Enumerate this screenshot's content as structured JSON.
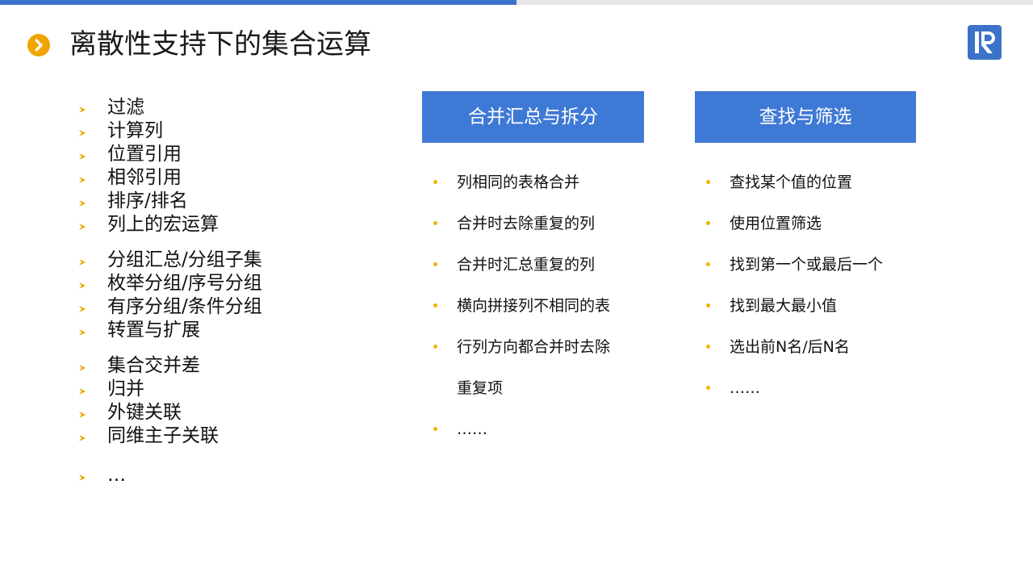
{
  "progress": {
    "fraction": 0.5,
    "fill_color": "#3c72c9",
    "track_color": "#e6e6e6"
  },
  "title": {
    "icon": "chevron-right-circle-icon",
    "icon_color": "#f0a500",
    "text": "离散性支持下的集合运算"
  },
  "logo": {
    "icon": "brand-logo-icon",
    "color": "#3c72c9"
  },
  "left_list": {
    "bullet_icon": "arrow-bullet-icon",
    "bullet_color": "#e6a800",
    "groups": [
      [
        "过滤",
        "计算列",
        "位置引用",
        "相邻引用",
        "排序/排名",
        "列上的宏运算"
      ],
      [
        "分组汇总/分组子集",
        "枚举分组/序号分组",
        "有序分组/条件分组",
        "转置与扩展"
      ],
      [
        "集合交并差",
        "归并",
        "外键关联",
        "同维主子关联"
      ],
      [
        "…"
      ]
    ]
  },
  "columns": [
    {
      "header": "合并汇总与拆分",
      "items": [
        "列相同的表格合并",
        "合并时去除重复的列",
        "合并时汇总重复的列",
        "横向拼接列不相同的表",
        "行列方向都合并时去除",
        "重复项",
        "……"
      ],
      "continuation_index": 5
    },
    {
      "header": "查找与筛选",
      "items": [
        "查找某个值的位置",
        "使用位置筛选",
        "找到第一个或最后一个",
        "找到最大最小值",
        "选出前N名/后N名",
        "……"
      ],
      "continuation_index": -1
    }
  ],
  "header_color": "#3f79d6",
  "dot_color": "#f0b400"
}
